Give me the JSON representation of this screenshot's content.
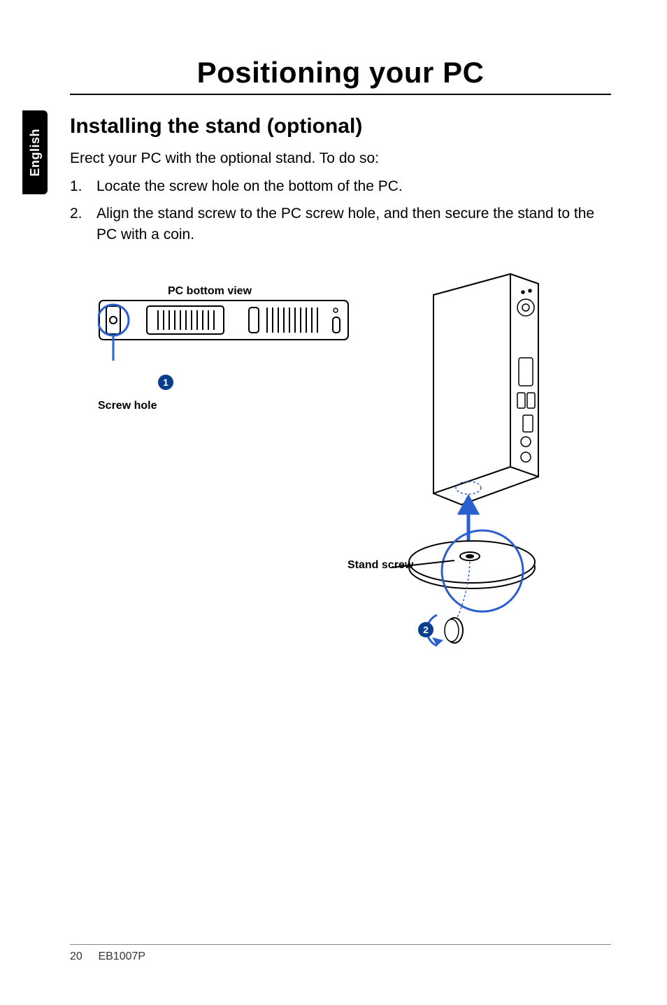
{
  "sidebar": {
    "language": "English"
  },
  "page": {
    "title": "Positioning your PC",
    "subheading": "Installing the stand (optional)",
    "lead": "Erect your PC with the optional stand. To do so:",
    "steps": [
      {
        "n": "1.",
        "text": "Locate the screw hole on the bottom of the PC."
      },
      {
        "n": "2.",
        "text": "Align the stand screw to the PC screw hole, and then secure the stand to the PC with a coin."
      }
    ]
  },
  "diagram": {
    "bottom_view_label": "PC bottom view",
    "screw_hole_label": "Screw hole",
    "stand_screw_label": "Stand screw",
    "callouts": {
      "one": "1",
      "two": "2"
    }
  },
  "footer": {
    "page_number": "20",
    "model": "EB1007P"
  }
}
